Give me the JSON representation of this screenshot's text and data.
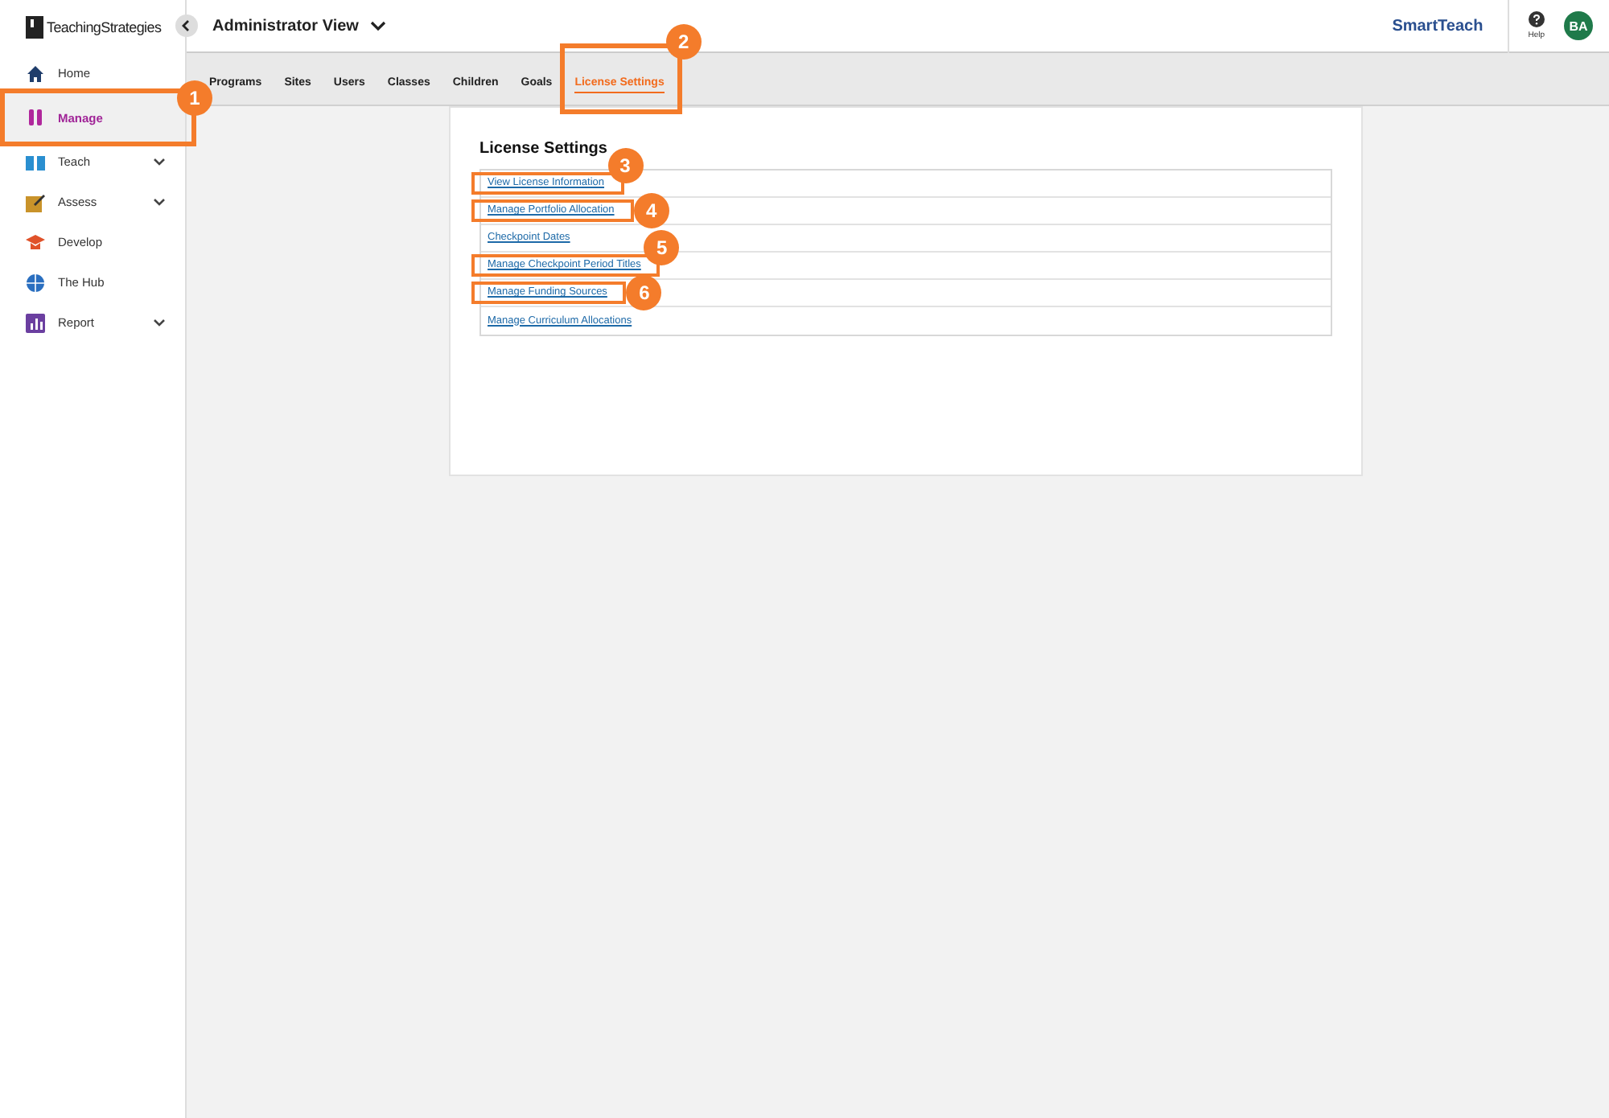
{
  "brand": {
    "logo": "TeachingStrategies",
    "product": "SmartTeach"
  },
  "header": {
    "view": "Administrator View",
    "help": "Help",
    "avatar": "BA"
  },
  "sidebar": {
    "items": [
      {
        "label": "Home",
        "kind": "home",
        "selected": false,
        "expandable": false
      },
      {
        "label": "Manage",
        "kind": "manage",
        "selected": true,
        "expandable": false,
        "callout": "1"
      },
      {
        "label": "Teach",
        "kind": "teach",
        "selected": false,
        "expandable": true
      },
      {
        "label": "Assess",
        "kind": "assess",
        "selected": false,
        "expandable": true
      },
      {
        "label": "Develop",
        "kind": "develop",
        "selected": false,
        "expandable": false
      },
      {
        "label": "The Hub",
        "kind": "hub",
        "selected": false,
        "expandable": false
      },
      {
        "label": "Report",
        "kind": "report",
        "selected": false,
        "expandable": true
      }
    ]
  },
  "tabs": [
    {
      "label": "Programs",
      "selected": false
    },
    {
      "label": "Sites",
      "selected": false
    },
    {
      "label": "Users",
      "selected": false
    },
    {
      "label": "Classes",
      "selected": false
    },
    {
      "label": "Children",
      "selected": false
    },
    {
      "label": "Goals",
      "selected": false
    },
    {
      "label": "License Settings",
      "selected": true,
      "callout": "2"
    }
  ],
  "panel": {
    "title": "License Settings",
    "links": [
      {
        "label": "View License Information",
        "callout": "3"
      },
      {
        "label": "Manage Portfolio Allocation",
        "callout": "4"
      },
      {
        "label": "Checkpoint Dates"
      },
      {
        "label": "Manage Checkpoint Period Titles",
        "callout": "5"
      },
      {
        "label": "Manage Funding Sources",
        "callout": "6"
      },
      {
        "label": "Manage Curriculum Allocations"
      }
    ]
  }
}
